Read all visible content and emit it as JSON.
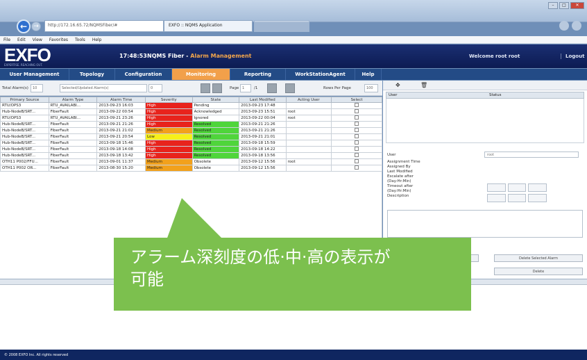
{
  "browser": {
    "address": "http://172.16.65.72/NQMSFiber/#",
    "tab_label": "EXFO :: NQMS Application",
    "menu": [
      "File",
      "Edit",
      "View",
      "Favorites",
      "Tools",
      "Help"
    ]
  },
  "app": {
    "logo": "EXFO",
    "logo_sub": "EXPERTISE. REACHING OUT.",
    "clock": "17:48:53",
    "title_prefix": "NQMS Fiber - ",
    "title_highlight": "Alarm Management",
    "welcome": "Welcome root root",
    "logout": "Logout"
  },
  "nav": [
    {
      "label": "User Management"
    },
    {
      "label": "Topology"
    },
    {
      "label": "Configuration"
    },
    {
      "label": "Monitoring"
    },
    {
      "label": "Reporting"
    },
    {
      "label": "WorkStationAgent"
    },
    {
      "label": "Help"
    }
  ],
  "toolbar": {
    "total_alarms_label": "Total Alarm(s)",
    "total_alarms_value": "10",
    "filter_label": "Selected/Updated Alarm(s)",
    "filter_value": "0",
    "page_label": "Page",
    "page_value": "1",
    "page_of": "/1",
    "rows_label": "Rows Per Page",
    "rows_value": "100"
  },
  "table": {
    "columns": [
      "Primary Source",
      "Alarm Type",
      "Alarm Time",
      "Severity",
      "State",
      "Last Modified",
      "Acting User",
      "Select"
    ],
    "rows": [
      {
        "source": "RTU/OPS3",
        "type": "RTU_AVAILABI...",
        "time": "2013-09-23 16:03",
        "severity": "High",
        "sev": "high",
        "state": "Pending",
        "st": "",
        "modified": "2013-09-23 17:48",
        "user": ""
      },
      {
        "source": "Hub-NodeB/SRT...",
        "type": "FiberFault",
        "time": "2013-09-22 00:54",
        "severity": "High",
        "sev": "high",
        "state": "Acknowledged",
        "st": "",
        "modified": "2013-09-23 15:51",
        "user": "root"
      },
      {
        "source": "RTU/OPS3",
        "type": "RTU_AVAILABI...",
        "time": "2013-09-21 23:26",
        "severity": "High",
        "sev": "high",
        "state": "Ignored",
        "st": "",
        "modified": "2013-09-22 00:04",
        "user": "root"
      },
      {
        "source": "Hub-NodeB/SRT...",
        "type": "FiberFault",
        "time": "2013-09-21 21:26",
        "severity": "High",
        "sev": "high",
        "state": "Resolved",
        "st": "resolved",
        "modified": "2013-09-21 21:26",
        "user": ""
      },
      {
        "source": "Hub-NodeB/SRT...",
        "type": "FiberFault",
        "time": "2013-09-21 21:02",
        "severity": "Medium",
        "sev": "medium",
        "state": "Resolved",
        "st": "resolved",
        "modified": "2013-09-21 21:26",
        "user": ""
      },
      {
        "source": "Hub-NodeB/SRT...",
        "type": "FiberFault",
        "time": "2013-09-21 20:54",
        "severity": "Low",
        "sev": "low",
        "state": "Resolved",
        "st": "resolved",
        "modified": "2013-09-21 21:01",
        "user": ""
      },
      {
        "source": "Hub-NodeB/SRT...",
        "type": "FiberFault",
        "time": "2013-09-18 15:46",
        "severity": "High",
        "sev": "high",
        "state": "Resolved",
        "st": "resolved",
        "modified": "2013-09-18 15:59",
        "user": ""
      },
      {
        "source": "Hub-NodeB/SRT...",
        "type": "FiberFault",
        "time": "2013-09-18 14:08",
        "severity": "High",
        "sev": "high",
        "state": "Resolved",
        "st": "resolved",
        "modified": "2013-09-18 14:22",
        "user": ""
      },
      {
        "source": "Hub-NodeB/SRT...",
        "type": "FiberFault",
        "time": "2013-09-18 13:42",
        "severity": "High",
        "sev": "high",
        "state": "Resolved",
        "st": "resolved",
        "modified": "2013-09-18 13:56",
        "user": ""
      },
      {
        "source": "OTH11 P002/FFU...",
        "type": "FiberFault",
        "time": "2013-09-01 11:37",
        "severity": "Medium",
        "sev": "medium",
        "state": "Obsolete",
        "st": "",
        "modified": "2013-09-12 15:56",
        "user": "root"
      },
      {
        "source": "OTH11 P002 OR...",
        "type": "FiberFault",
        "time": "2013-08-30 15:20",
        "severity": "Medium",
        "sev": "medium",
        "state": "Obsolete",
        "st": "",
        "modified": "2013-09-12 15:56",
        "user": ""
      }
    ]
  },
  "right": {
    "head_user": "User",
    "head_status": "Status",
    "user_label": "User",
    "user_value": "root",
    "fields": [
      "Assignment Time",
      "Assigned By",
      "Last Modified",
      "Escalate after",
      "(Day:Hr:Min)",
      "Timeout after",
      "(Day:Hr:Min)",
      "Description"
    ],
    "delete_selected": "Delete Selected Alarm",
    "delete": "Delete"
  },
  "footer": "© 2008 EXFO Inc. All rights reserved",
  "callout": {
    "line1": "アラーム深刻度の低·中·高の表示が",
    "line2": "可能"
  },
  "colors": {
    "high": "#e8231c",
    "medium": "#f2a11c",
    "low": "#f7ef1a",
    "resolved": "#4fd53b",
    "callout": "#7cc04e",
    "nav_active": "#f2a04a"
  }
}
